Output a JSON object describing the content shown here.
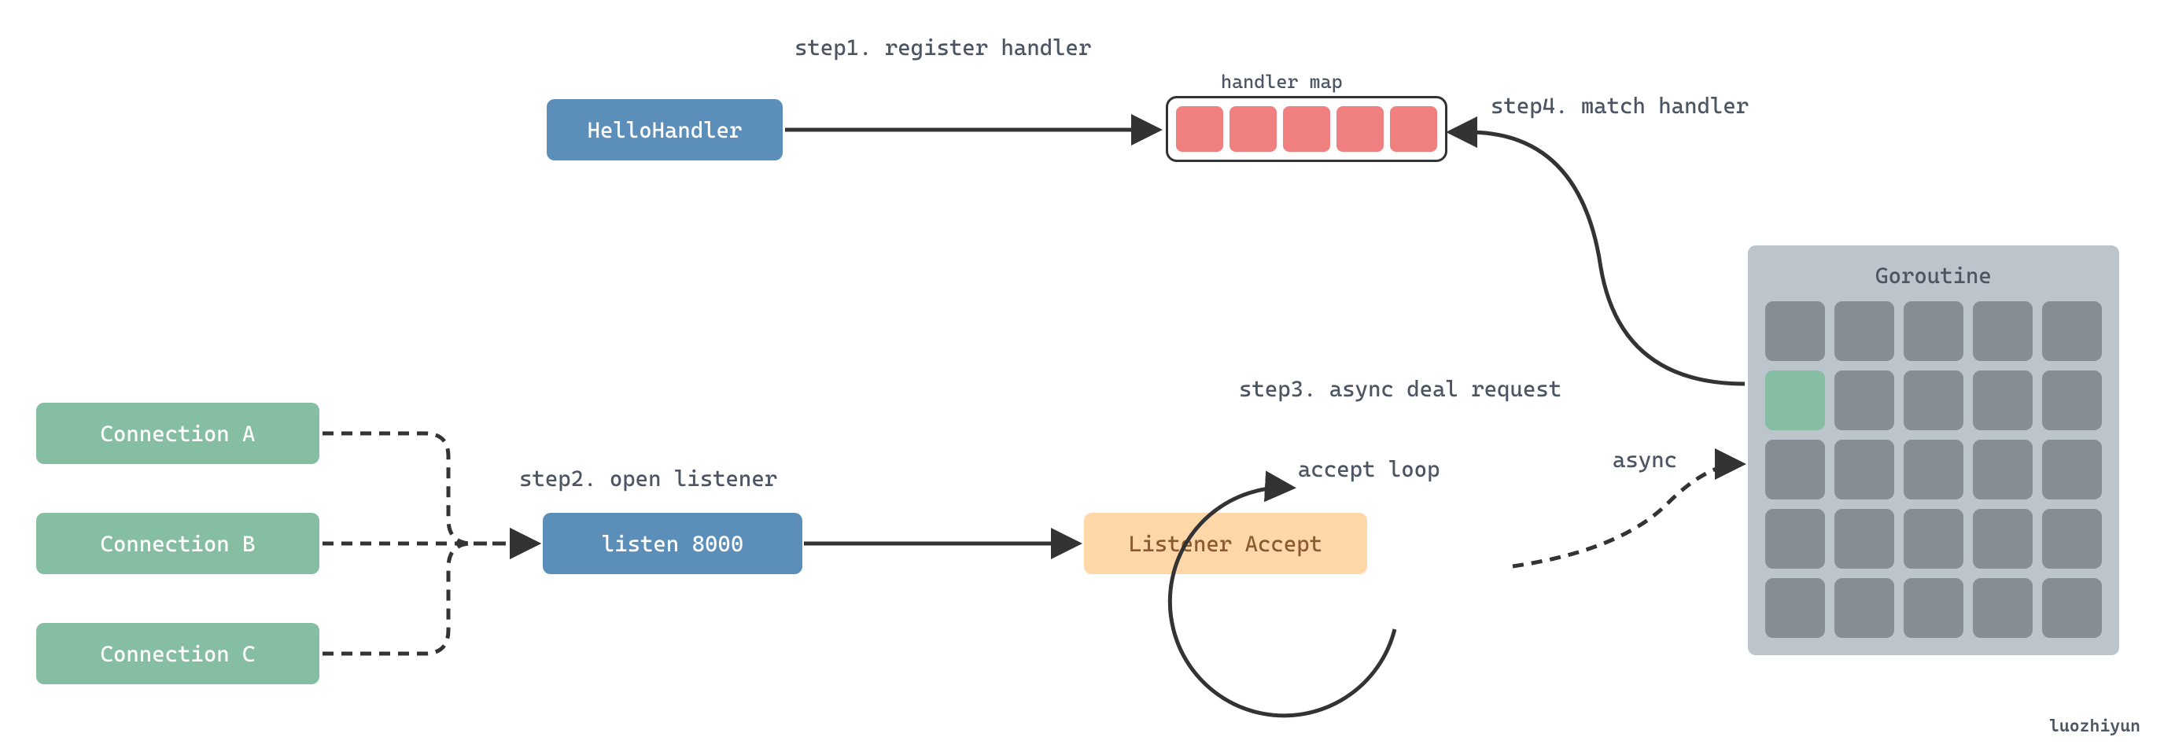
{
  "steps": {
    "s1": "step1. register handler",
    "s2": "step2. open listener",
    "s3": "step3. async deal request",
    "s4": "step4. match handler"
  },
  "boxes": {
    "helloHandler": "HelloHandler",
    "listen": "listen 8000",
    "listenerAccept": "Listener Accept",
    "connA": "Connection A",
    "connB": "Connection B",
    "connC": "Connection C"
  },
  "labels": {
    "handlerMap": "handler map",
    "acceptLoop": "accept loop",
    "async": "async",
    "goroutine": "Goroutine"
  },
  "watermark": "luozhiyun",
  "colors": {
    "blue": "#5b8fba",
    "green": "#85bea2",
    "peach": "#ffd7a8",
    "red": "#f08080",
    "greyCell": "#868d95",
    "panel": "#bcc4cc"
  },
  "handlerMap": {
    "cells": 5
  },
  "goroutine": {
    "rows": 5,
    "cols": 5,
    "activeIndex": 5
  }
}
